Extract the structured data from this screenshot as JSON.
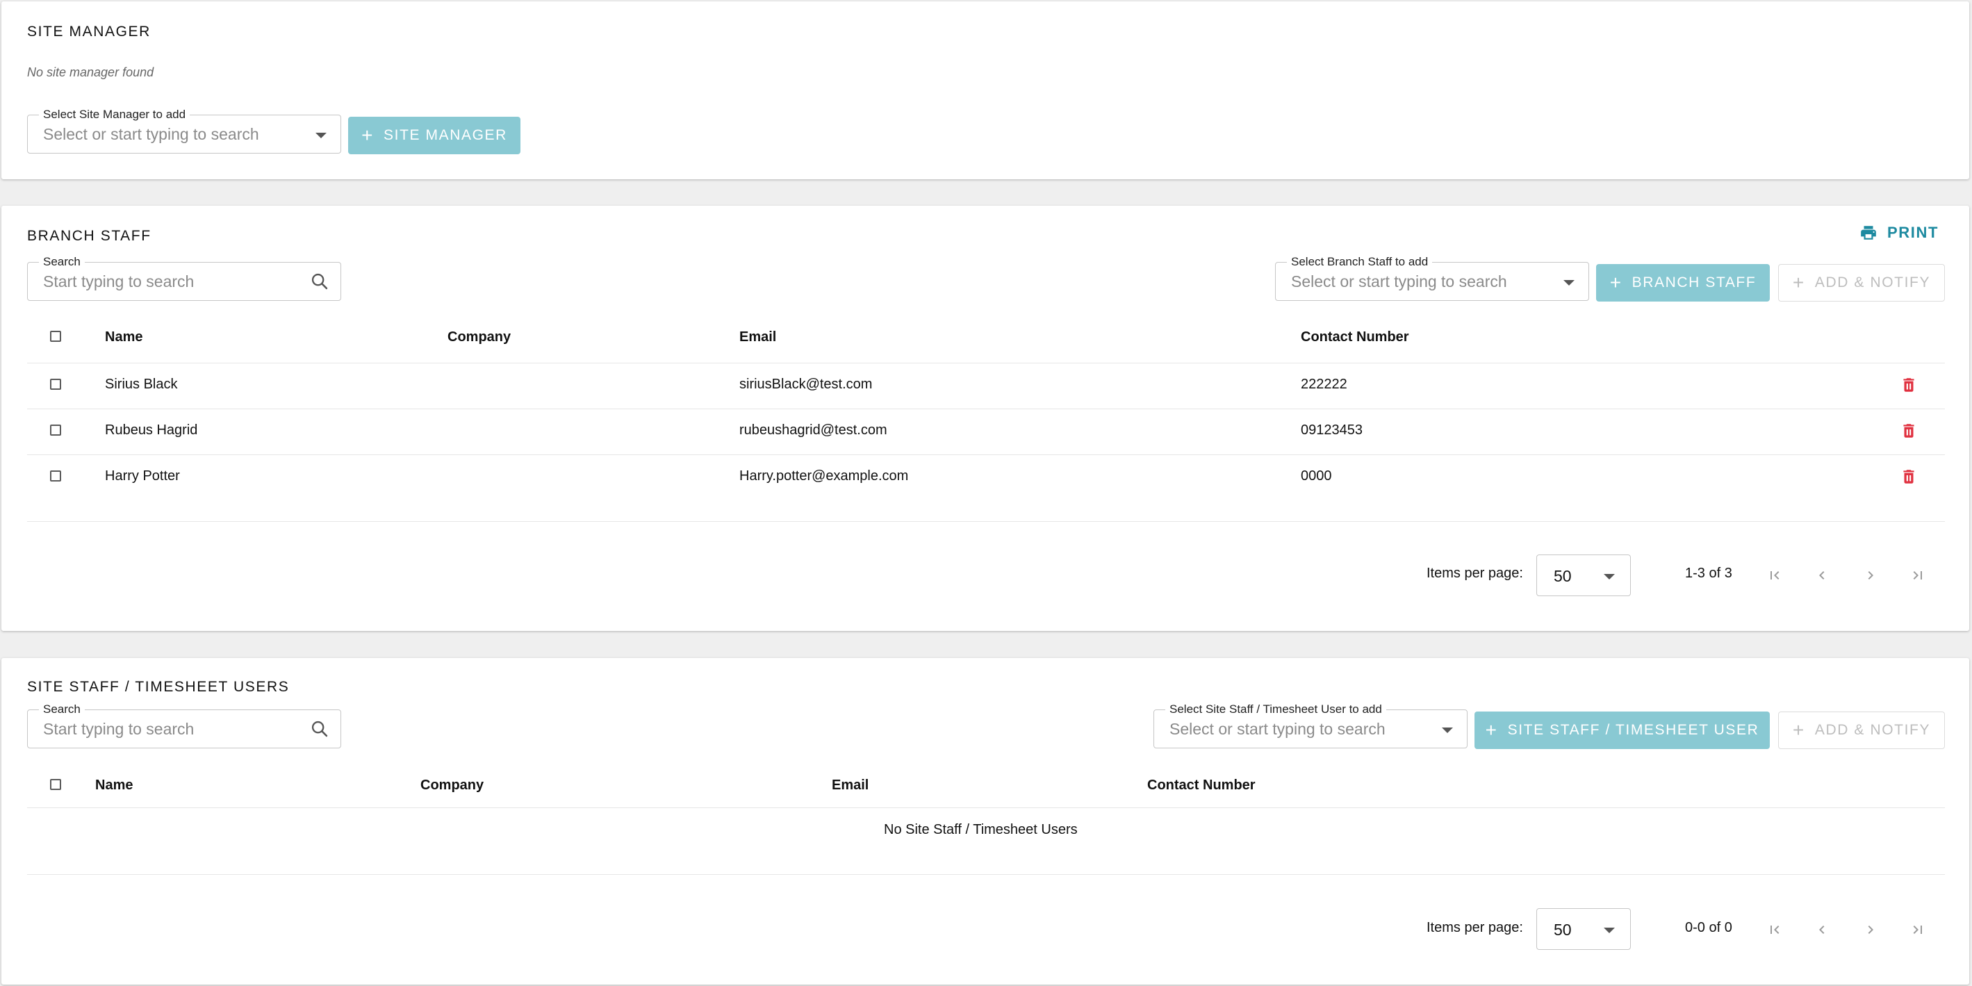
{
  "site_manager": {
    "title": "SITE MANAGER",
    "empty_text": "No site manager found",
    "select_label": "Select Site Manager to add",
    "select_placeholder": "Select or start typing to search",
    "add_button": "SITE MANAGER"
  },
  "branch_staff": {
    "title": "BRANCH STAFF",
    "print_label": "PRINT",
    "search_label": "Search",
    "search_placeholder": "Start typing to search",
    "select_label": "Select Branch Staff to add",
    "select_placeholder": "Select or start typing to search",
    "add_button": "BRANCH STAFF",
    "notify_button": "ADD & NOTIFY",
    "columns": [
      "Name",
      "Company",
      "Email",
      "Contact Number"
    ],
    "rows": [
      {
        "name": "Sirius Black",
        "company": "",
        "email": "siriusBlack@test.com",
        "contact": "222222"
      },
      {
        "name": "Rubeus Hagrid",
        "company": "",
        "email": "rubeushagrid@test.com",
        "contact": "09123453"
      },
      {
        "name": "Harry Potter",
        "company": "",
        "email": "Harry.potter@example.com",
        "contact": "0000"
      }
    ],
    "paginator": {
      "items_label": "Items per page:",
      "page_size": "50",
      "range": "1-3 of 3"
    }
  },
  "site_staff": {
    "title": "SITE STAFF / TIMESHEET USERS",
    "search_label": "Search",
    "search_placeholder": "Start typing to search",
    "select_label": "Select Site Staff / Timesheet User to add",
    "select_placeholder": "Select or start typing to search",
    "add_button": "SITE STAFF / TIMESHEET USER",
    "notify_button": "ADD & NOTIFY",
    "columns": [
      "Name",
      "Company",
      "Email",
      "Contact Number"
    ],
    "empty_text": "No Site Staff / Timesheet Users",
    "paginator": {
      "items_label": "Items per page:",
      "page_size": "50",
      "range": "0-0 of 0"
    }
  },
  "colors": {
    "primary_button": "#89c9d3",
    "print_link": "#1d8aa0",
    "delete_icon": "#e0303f"
  }
}
